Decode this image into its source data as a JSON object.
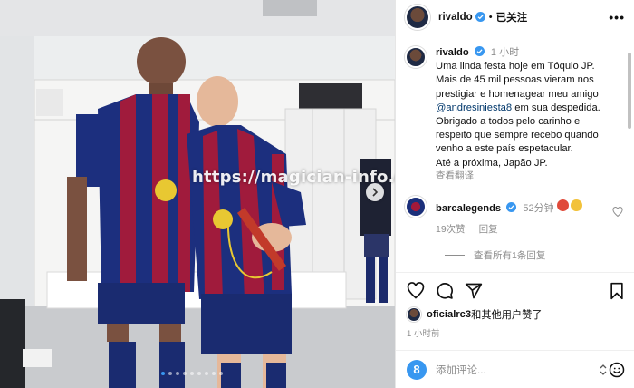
{
  "watermark": "https://magician-info.com/",
  "header": {
    "username": "rivaldo",
    "separator": "•",
    "follow_state": "已关注",
    "more": "•••"
  },
  "caption": {
    "username": "rivaldo",
    "time": "1 小时",
    "text": "Uma linda festa hoje em Tóquio JP.\nMais de 45 mil pessoas vieram nos prestigiar e homenagear meu amigo",
    "mention": "@andresiniesta8",
    "text_after": " em sua despedida.\nObrigado a todos pelo carinho e respeito que sempre recebo quando venho a este país espetacular.\nAté a próxima, Japão JP.",
    "see_translation": "查看翻译"
  },
  "comment": {
    "username": "barcalegends",
    "time": "52分钟",
    "likes": "19次赞",
    "reply": "回复",
    "view_replies": "查看所有1条回复"
  },
  "likes": {
    "user": "oficialrc3",
    "text": "和其他用户赞了"
  },
  "post_time": "1 小时前",
  "comment_input": {
    "placeholder": "添加评论..."
  },
  "colors": {
    "verified": "#3897f0",
    "mention": "#00376b",
    "muted": "#8e8e8e",
    "barca_blue": "#1b2f7a",
    "barca_red": "#a3193a"
  },
  "icons": [
    "verified-icon",
    "more-icon",
    "heart-icon",
    "comment-icon",
    "share-icon",
    "save-icon",
    "next-icon",
    "gif-icon",
    "emoji-icon"
  ]
}
